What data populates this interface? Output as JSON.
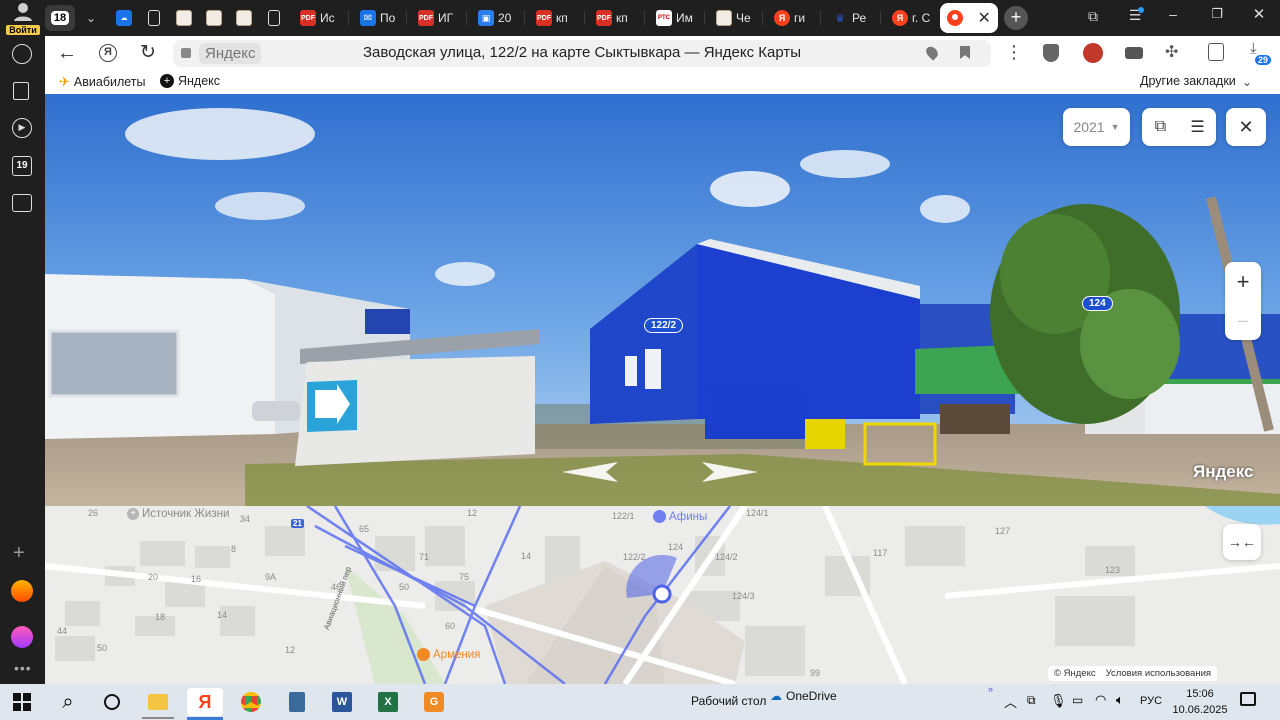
{
  "browser": {
    "login_label": "Войти",
    "tab_count": "18",
    "tabs": [
      {
        "label": "Ис",
        "icon": "pdf-icon"
      },
      {
        "label": "По",
        "icon": "mail-icon"
      },
      {
        "label": "ИГ",
        "icon": "pdf-icon"
      },
      {
        "label": "20",
        "icon": "gallery-icon"
      },
      {
        "label": "кп",
        "icon": "pdf-icon"
      },
      {
        "label": "кп",
        "icon": "pdf-icon"
      },
      {
        "label": "Им",
        "icon": "rts-icon"
      },
      {
        "label": "Че",
        "icon": "doc-icon"
      },
      {
        "label": "ги",
        "icon": "yandex-icon"
      },
      {
        "label": "Ре",
        "icon": "emblem-icon"
      },
      {
        "label": "г. С",
        "icon": "yandex-icon"
      }
    ],
    "pdf_badge": "PDF",
    "rts_badge": "РТС",
    "yandex_badge": "Я",
    "address_prefix": "Яндекс",
    "page_title": "Заводская улица, 122/2 на карте Сыктывкара — Яндекс Карты",
    "downloads_badge": "29",
    "bookmarks": [
      {
        "label": "Авиабилеты",
        "icon": "plane-icon"
      },
      {
        "label": "Яндекс",
        "icon": "yandex-plus-icon"
      }
    ],
    "other_bookmarks": "Другие закладки",
    "sidebar_calendar": "19"
  },
  "panorama": {
    "year": "2021",
    "house_label_main": "122/2",
    "house_label_right": "124",
    "watermark": "Яндекс",
    "zoom_in": "+",
    "zoom_out": "–"
  },
  "map": {
    "poi_top": "Источник Жизни",
    "poi_cinema": "Афины",
    "poi_cafe": "Армения",
    "street": "Авиационный пер",
    "road_badge": "21",
    "house_numbers": [
      "26",
      "34",
      "8",
      "9А",
      "20",
      "16",
      "18",
      "14",
      "44",
      "50",
      "12",
      "65",
      "71",
      "75",
      "50",
      "46",
      "60",
      "14",
      "12",
      "122/1",
      "124/1",
      "122/2",
      "124",
      "124/2",
      "124/3",
      "117",
      "127",
      "123",
      "99"
    ],
    "copyright": "© Яндекс",
    "terms": "Условия использования"
  },
  "taskbar": {
    "desktop_label": "Рабочий стол",
    "onedrive": "OneDrive",
    "language": "РУС",
    "time": "15:06",
    "date": "10.06.2025"
  },
  "colors": {
    "tab_bg": "#1f1f1f",
    "yandex_red": "#fc3f1d",
    "map_route": "#5b6ff2",
    "building_blue": "#1c3fd0"
  }
}
